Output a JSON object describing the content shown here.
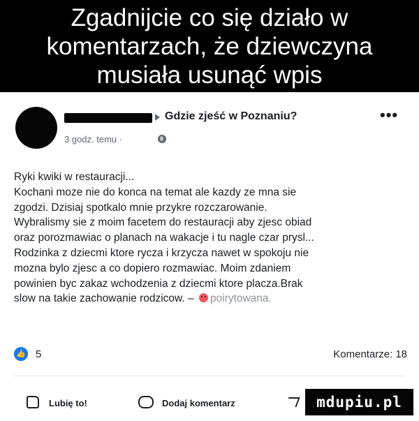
{
  "meme": {
    "headline_lines": [
      "Zgadnijcie co się działo w",
      "komentarzach, że dziewczyna",
      "musiała usunąć wpis"
    ]
  },
  "post": {
    "group_title": "Gdzie zjeść w Poznaniu?",
    "time": "3 godz. temu ·",
    "more_label": "•••",
    "body_lines": [
      "Ryki kwiki w restauracji...",
      "Kochani moze nie do konca na temat ale kazdy ze mna sie",
      "zgodzi. Dzisiaj spotkalo mnie przykre rozczarowanie.",
      "Wybralismy sie z moim facetem do restauracji aby zjesc obiad",
      "oraz porozmawiac o planach na wakacje i tu nagle czar prysl...",
      "Rodzinka z dziecmi ktore rycza i krzycza nawet w spokoju nie",
      "mozna bylo zjesc a co dopiero rozmawiac. Moim zdaniem",
      "powinien byc zakaz wchodzenia z dziecmi ktore placza.Brak"
    ],
    "last_line_text": "slow na takie zachowanie rodzicow. –",
    "feeling": "poirytowana."
  },
  "reactions": {
    "like_glyph": "👍",
    "count": "5",
    "comments_label": "Komentarze:",
    "comments_count": "18"
  },
  "actions": {
    "like": "Lubię to!",
    "comment": "Dodaj komentarz"
  },
  "watermark": "mdupiu.pl",
  "colors": {
    "accent": "#1877f2",
    "text": "#1c1e21",
    "secondary_text": "#606770"
  }
}
